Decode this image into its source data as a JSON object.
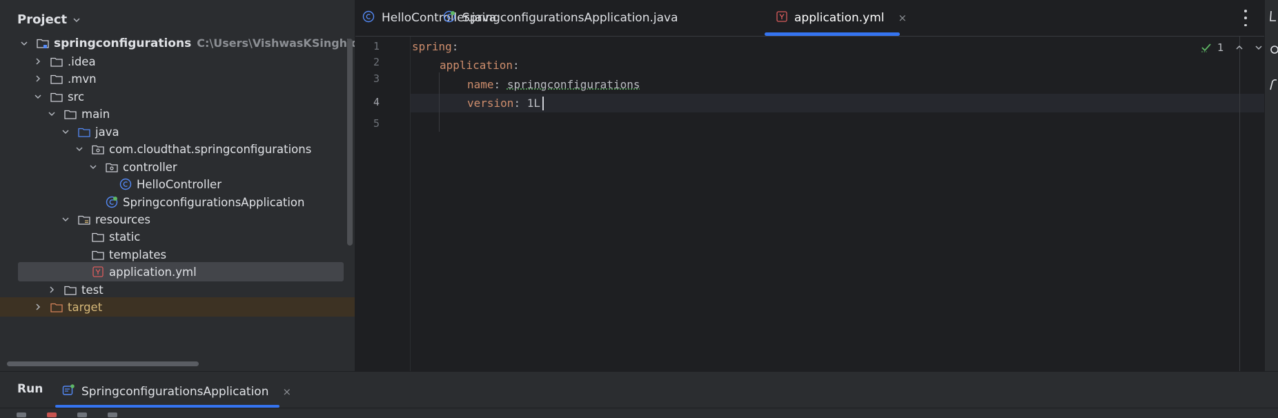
{
  "project_panel": {
    "title": "Project",
    "tree": [
      {
        "label": "springconfigurations",
        "path": "C:\\Users\\VishwasKSingh\\deloitt",
        "expanded": true,
        "icon": "module-folder-icon"
      },
      {
        "label": ".idea",
        "expanded": false,
        "icon": "folder-icon"
      },
      {
        "label": ".mvn",
        "expanded": false,
        "icon": "folder-icon"
      },
      {
        "label": "src",
        "expanded": true,
        "icon": "folder-icon"
      },
      {
        "label": "main",
        "expanded": true,
        "icon": "folder-icon"
      },
      {
        "label": "java",
        "expanded": true,
        "icon": "source-folder-icon"
      },
      {
        "label": "com.cloudthat.springconfigurations",
        "expanded": true,
        "icon": "package-icon"
      },
      {
        "label": "controller",
        "expanded": true,
        "icon": "package-icon"
      },
      {
        "label": "HelloController",
        "icon": "class-icon"
      },
      {
        "label": "SpringconfigurationsApplication",
        "icon": "spring-boot-class-icon"
      },
      {
        "label": "resources",
        "expanded": true,
        "icon": "resources-folder-icon"
      },
      {
        "label": "static",
        "icon": "folder-icon"
      },
      {
        "label": "templates",
        "icon": "folder-icon"
      },
      {
        "label": "application.yml",
        "icon": "yaml-file-icon",
        "selected": true
      },
      {
        "label": "test",
        "expanded": false,
        "icon": "folder-icon"
      },
      {
        "label": "target",
        "expanded": false,
        "icon": "excluded-folder-icon"
      }
    ]
  },
  "editor": {
    "tabs": [
      {
        "label": "HelloController.java",
        "icon": "class-icon"
      },
      {
        "label": "SpringconfigurationsApplication.java",
        "icon": "spring-boot-class-icon"
      },
      {
        "label": "application.yml",
        "icon": "yaml-file-icon",
        "active": true,
        "close": "×"
      }
    ],
    "line_numbers": [
      "1",
      "2",
      "3",
      "4",
      "5"
    ],
    "code": {
      "l1_key": "spring",
      "colon": ":",
      "l2_key": "application",
      "l3_key": "name",
      "l3_val": "springconfigurations",
      "l4_key": "version",
      "l4_val": "1L"
    },
    "inspection": {
      "count": "1"
    }
  },
  "run_panel": {
    "title": "Run",
    "tab_label": "SpringconfigurationsApplication",
    "close": "×"
  },
  "colors": {
    "accent": "#3574f0",
    "yaml_key": "#cf8e6d",
    "selection": "#43454a"
  }
}
